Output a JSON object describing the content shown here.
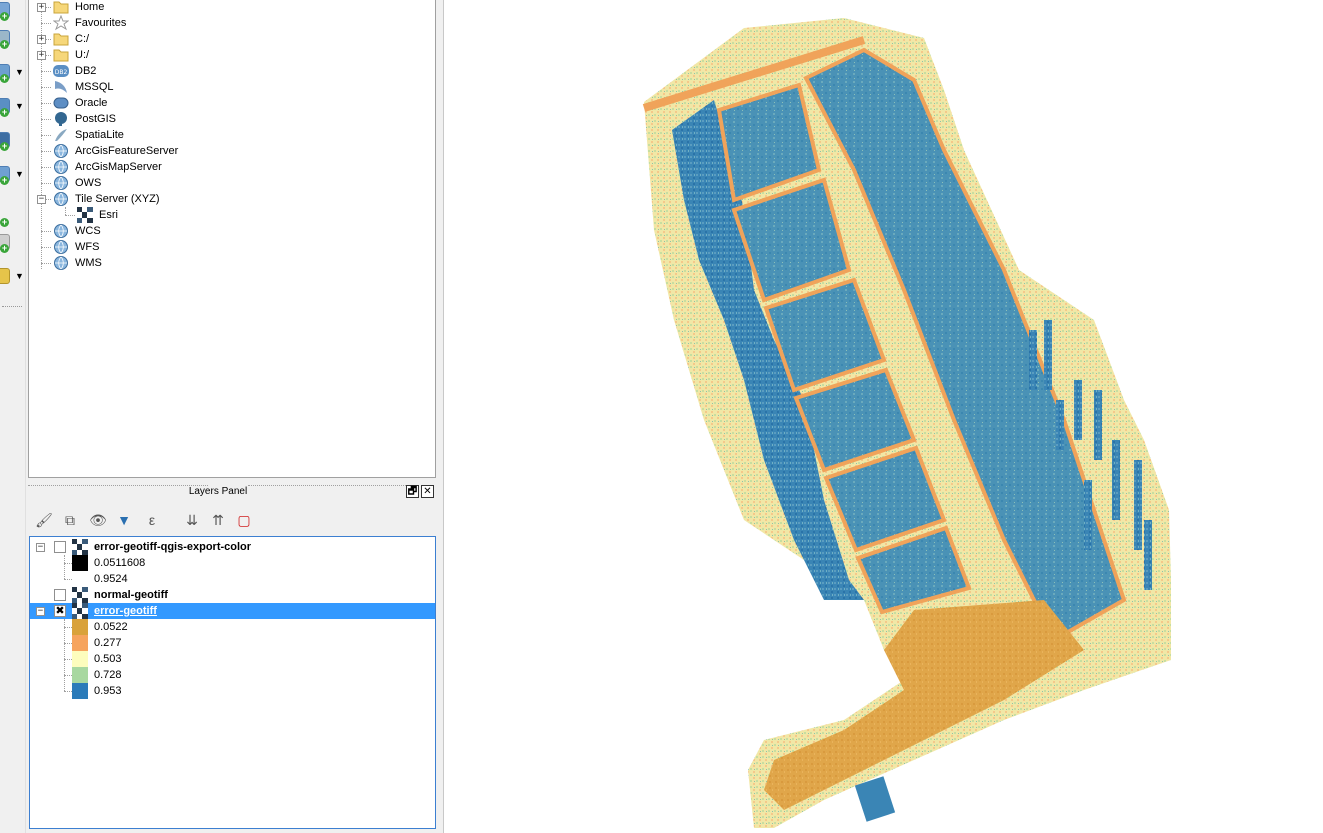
{
  "browser": {
    "items": [
      {
        "label": "Home",
        "icon": "folder-icon",
        "expandable": true
      },
      {
        "label": "Favourites",
        "icon": "star-icon",
        "expandable": false
      },
      {
        "label": "C:/",
        "icon": "folder-icon",
        "expandable": true
      },
      {
        "label": "U:/",
        "icon": "folder-icon",
        "expandable": true
      },
      {
        "label": "DB2",
        "icon": "db2-icon",
        "expandable": false
      },
      {
        "label": "MSSQL",
        "icon": "mssql-icon",
        "expandable": false
      },
      {
        "label": "Oracle",
        "icon": "oracle-icon",
        "expandable": false
      },
      {
        "label": "PostGIS",
        "icon": "postgis-icon",
        "expandable": false
      },
      {
        "label": "SpatiaLite",
        "icon": "spatialite-icon",
        "expandable": false
      },
      {
        "label": "ArcGisFeatureServer",
        "icon": "arcgis-feature-icon",
        "expandable": false
      },
      {
        "label": "ArcGisMapServer",
        "icon": "arcgis-map-icon",
        "expandable": false
      },
      {
        "label": "OWS",
        "icon": "ows-icon",
        "expandable": false
      },
      {
        "label": "Tile Server (XYZ)",
        "icon": "globe-icon",
        "expandable": true,
        "expanded": true
      },
      {
        "label": "Esri",
        "icon": "raster-icon",
        "child": true
      },
      {
        "label": "WCS",
        "icon": "wcs-icon",
        "expandable": false
      },
      {
        "label": "WFS",
        "icon": "wfs-icon",
        "expandable": false
      },
      {
        "label": "WMS",
        "icon": "wms-icon",
        "expandable": false
      }
    ],
    "db2_badge": "DB2"
  },
  "layers_panel": {
    "title": "Layers Panel",
    "float_button": "🗗",
    "close_button": "✕",
    "toolbar": [
      {
        "name": "style-brush-icon",
        "glyph": "🖌"
      },
      {
        "name": "add-group-icon",
        "glyph": "⧉"
      },
      {
        "name": "visibility-eye-icon",
        "glyph": "👁"
      },
      {
        "name": "filter-icon",
        "glyph": "▼"
      },
      {
        "name": "expression-filter-icon",
        "glyph": "ε"
      },
      {
        "name": "expand-all-icon",
        "glyph": "⇊"
      },
      {
        "name": "collapse-all-icon",
        "glyph": "⇈"
      },
      {
        "name": "remove-layer-icon",
        "glyph": "▢"
      }
    ],
    "layers": [
      {
        "name": "error-geotiff-qgis-export-color",
        "checked": false,
        "selected": false,
        "expanded": true,
        "legend": [
          {
            "color": "#000000",
            "value": "0.0511608"
          },
          {
            "color": "#ffffff",
            "value": "0.9524"
          }
        ]
      },
      {
        "name": "normal-geotiff",
        "checked": false,
        "selected": false,
        "expanded": false,
        "legend": []
      },
      {
        "name": "error-geotiff",
        "checked": true,
        "selected": true,
        "expanded": true,
        "legend": [
          {
            "color": "#d9a23b",
            "value": "0.0522"
          },
          {
            "color": "#f6a45e",
            "value": "0.277"
          },
          {
            "color": "#fdfdbd",
            "value": "0.503"
          },
          {
            "color": "#a8d8a0",
            "value": "0.728"
          },
          {
            "color": "#2b7bb9",
            "value": "0.953"
          }
        ]
      }
    ]
  },
  "colors": {
    "accent": "#3399ff",
    "ramp_low": "#d9a23b",
    "ramp_mid": "#fdfdbd",
    "ramp_high": "#2b7bb9"
  }
}
